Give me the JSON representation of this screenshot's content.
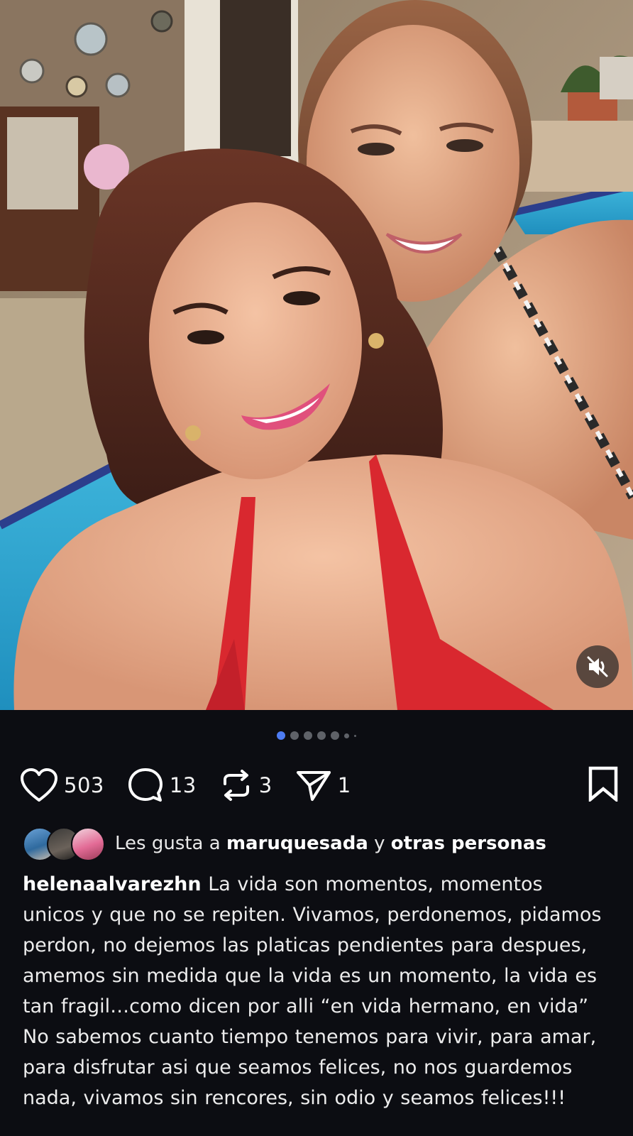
{
  "post": {
    "media": {
      "carousel": {
        "count": 7,
        "active_index": 0
      },
      "mute_icon": "speaker-muted-icon",
      "colors": {
        "pool": "#2aa9d4",
        "bikini": "#d9282f"
      }
    },
    "actions": {
      "likes": "503",
      "comments": "13",
      "reposts": "3",
      "shares": "1"
    },
    "liked_by": {
      "prefix": "Les gusta a",
      "user": "maruquesada",
      "connector": "y",
      "others": "otras personas"
    },
    "caption": {
      "username": "helenaalvarezhn",
      "text": "La vida son momentos, momentos unicos y que no se repiten. Vivamos, perdonemos, pidamos perdon, no dejemos las platicas pendientes para despues, amemos sin medida que la vida es un momento, la vida es tan fragil…como dicen por alli “en vida hermano, en vida” No sabemos cuanto tiempo tenemos para vivir, para amar, para disfrutar asi que seamos felices, no nos guardemos nada, vivamos sin rencores, sin odio y seamos felices!!!"
    }
  }
}
